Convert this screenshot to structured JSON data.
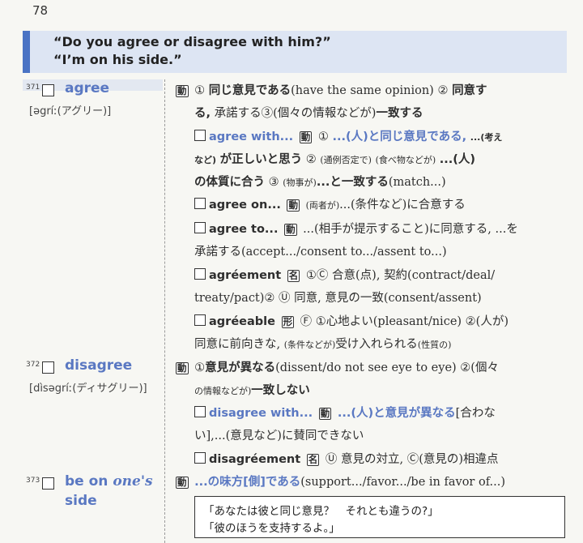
{
  "page_number": "78",
  "header": {
    "line1": "“Do you agree or disagree with him?”",
    "line2": "“I’m on his side.”"
  },
  "entries": [
    {
      "number": "371",
      "headword": "agree",
      "pronunciation": "[əgríː(アグリー)]",
      "lines": {
        "l1": {
          "a": "動",
          "b": "①",
          "c": "同じ意見である",
          "d": "(have the same opinion)",
          "e": "②",
          "f": "同意す"
        },
        "l2": {
          "a": "る,",
          "b": " 承諾する",
          "c": "③(個々の情報などが)",
          "d": "一致する"
        },
        "l3": {
          "a": "agree with...",
          "b": "動",
          "c": "①",
          "d": "...(人)と同じ意見である,",
          "e": "...(考え"
        },
        "l4": {
          "a": "など)",
          "b": "が正しいと思う",
          "c": "②",
          "d": "(通例否定で)",
          "e": "(食べ物などが)",
          "f": "...(人)"
        },
        "l5": {
          "a": "の体質に合う",
          "b": "③",
          "c": "(物事が)",
          "d": "...と一致する",
          "e": "(match...)"
        },
        "l6": {
          "a": "agree on...",
          "b": "動",
          "c": "(両者が)",
          "d": "...(条件など)に合意する"
        },
        "l7": {
          "a": "agree to...",
          "b": "動",
          "c": "...(相手が提示すること)に同意する,",
          "d": "...を"
        },
        "l8": {
          "a": "承諾する",
          "b": "(accept.../consent to.../assent to...)"
        },
        "l9": {
          "a": "agréement",
          "b": "名",
          "c": "①",
          "d": "Ⓒ",
          "e": "合意(点),",
          "f": "契約(contract/deal/"
        },
        "l10": {
          "a": "treaty/pact)",
          "b": "②",
          "c": "Ⓤ",
          "d": "同意,",
          "e": "意見の一致(consent/assent)"
        },
        "l11": {
          "a": "agréeable",
          "b": "形",
          "c": "Ⓕ",
          "d": "①心地よい(pleasant/nice)",
          "e": "②(人が)"
        },
        "l12": {
          "a": "同意に前向きな,",
          "b": "(条件などが)",
          "c": "受け入れられる",
          "d": "(性質の)"
        }
      }
    },
    {
      "number": "372",
      "headword": "disagree",
      "pronunciation": "[dìsəgríː(ディサグリー)]",
      "lines": {
        "l1": {
          "a": "動",
          "b": "①",
          "c": "意見が異なる",
          "d": "(dissent/do not see eye to eye)",
          "e": "②(個々"
        },
        "l2": {
          "a": "の情報などが)",
          "b": "一致しない"
        },
        "l3": {
          "a": "disagree with...",
          "b": "動",
          "c": "...(人)と意見が異なる",
          "d": "[合わな"
        },
        "l4": {
          "a": "い],",
          "b": "...(意見など)に賛同できない"
        },
        "l5": {
          "a": "disagréement",
          "b": "名",
          "c": "Ⓤ",
          "d": "意見の対立,",
          "e": "Ⓒ(意見の)相違点"
        }
      }
    },
    {
      "number": "373",
      "headword_a": "be on ",
      "headword_b": "one's",
      "headword_c": "side",
      "lines": {
        "l1": {
          "a": "動",
          "b": "...の味方[側]である",
          "c": "(support.../favor.../be in favor of...)"
        }
      },
      "example": {
        "ja1": "「あなたは彼と同じ意見？　それとも違うの?」",
        "ja2": "「彼のほうを支持するよ。」"
      }
    }
  ],
  "colors": {
    "accent_blue": "#5a78c2",
    "header_band": "#dde5f3",
    "header_bar": "#4a73c4"
  }
}
